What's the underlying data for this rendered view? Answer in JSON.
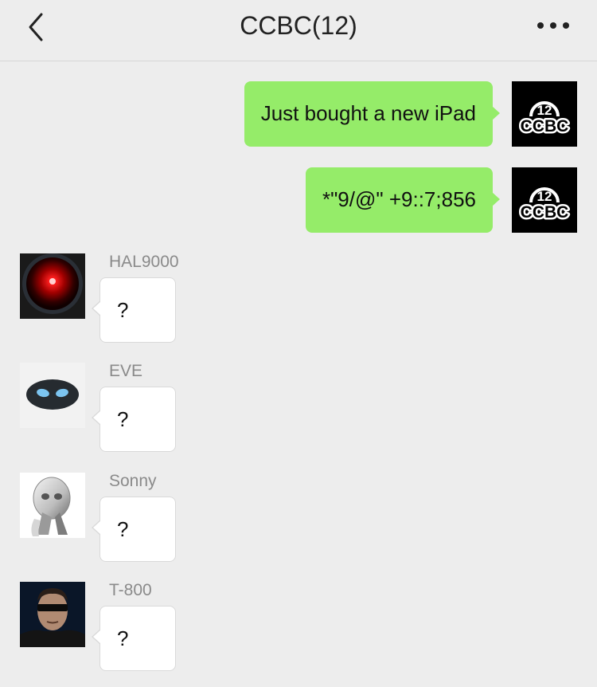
{
  "header": {
    "back_icon": "chevron-left-icon",
    "title": "CCBC(12)",
    "more_icon": "more-dots-icon"
  },
  "messages_out": [
    {
      "text": "Just bought a new iPad",
      "avatar_logo": {
        "number": "12",
        "letters": "CCBC"
      }
    },
    {
      "text": "*\"9/@\" +9::7;856",
      "avatar_logo": {
        "number": "12",
        "letters": "CCBC"
      }
    }
  ],
  "messages_in": [
    {
      "sender": "HAL9000",
      "text": "?"
    },
    {
      "sender": "EVE",
      "text": "?"
    },
    {
      "sender": "Sonny",
      "text": "?"
    },
    {
      "sender": "T-800",
      "text": "?"
    }
  ],
  "colors": {
    "background": "#ededed",
    "outgoing_bubble": "#95ec69",
    "incoming_bubble": "#ffffff",
    "sender_name": "#8a8a8a"
  }
}
